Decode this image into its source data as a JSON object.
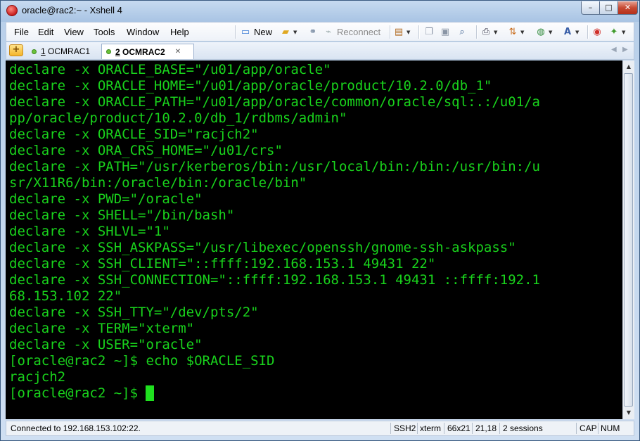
{
  "window": {
    "title": "oracle@rac2:~ - Xshell 4",
    "controls": {
      "minimize": "–",
      "maximize": "□",
      "close": "✕"
    }
  },
  "menu": [
    "File",
    "Edit",
    "View",
    "Tools",
    "Window",
    "Help"
  ],
  "toolbar": {
    "new_label": "New",
    "reconnect_label": "Reconnect"
  },
  "tabs": [
    {
      "number": "1",
      "label": "OCMRAC1",
      "active": false
    },
    {
      "number": "2",
      "label": "OCMRAC2",
      "active": true
    }
  ],
  "terminal": {
    "lines": [
      "declare -x ORACLE_BASE=\"/u01/app/oracle\"",
      "declare -x ORACLE_HOME=\"/u01/app/oracle/product/10.2.0/db_1\"",
      "declare -x ORACLE_PATH=\"/u01/app/oracle/common/oracle/sql:.:/u01/a",
      "pp/oracle/product/10.2.0/db_1/rdbms/admin\"",
      "declare -x ORACLE_SID=\"racjch2\"",
      "declare -x ORA_CRS_HOME=\"/u01/crs\"",
      "declare -x PATH=\"/usr/kerberos/bin:/usr/local/bin:/bin:/usr/bin:/u",
      "sr/X11R6/bin:/oracle/bin:/oracle/bin\"",
      "declare -x PWD=\"/oracle\"",
      "declare -x SHELL=\"/bin/bash\"",
      "declare -x SHLVL=\"1\"",
      "declare -x SSH_ASKPASS=\"/usr/libexec/openssh/gnome-ssh-askpass\"",
      "declare -x SSH_CLIENT=\"::ffff:192.168.153.1 49431 22\"",
      "declare -x SSH_CONNECTION=\"::ffff:192.168.153.1 49431 ::ffff:192.1",
      "68.153.102 22\"",
      "declare -x SSH_TTY=\"/dev/pts/2\"",
      "declare -x TERM=\"xterm\"",
      "declare -x USER=\"oracle\"",
      "[oracle@rac2 ~]$ echo $ORACLE_SID",
      "racjch2"
    ],
    "prompt": "[oracle@rac2 ~]$ "
  },
  "status": {
    "connection": "Connected to 192.168.153.102:22.",
    "protocol": "SSH2",
    "terminal_type": "xterm",
    "size": "66x21",
    "cursor_pos": "21,18",
    "sessions": "2 sessions",
    "caps": "CAP",
    "num": "NUM"
  },
  "colors": {
    "terminal_bg": "#000000",
    "terminal_fg": "#19d21c",
    "cursor": "#1fe01f"
  }
}
